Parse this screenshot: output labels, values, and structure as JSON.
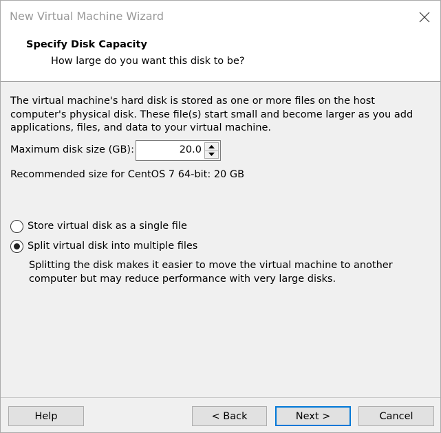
{
  "window": {
    "title": "New Virtual Machine Wizard"
  },
  "header": {
    "title": "Specify Disk Capacity",
    "subtitle": "How large do you want this disk to be?"
  },
  "body": {
    "description": "The virtual machine's hard disk is stored as one or more files on the host computer's physical disk. These file(s) start small and become larger as you add applications, files, and data to your virtual machine.",
    "disk_size_label": "Maximum disk size (GB):",
    "disk_size_value": "20.0",
    "recommended": "Recommended size for CentOS 7 64-bit: 20 GB"
  },
  "options": {
    "single_file_label": "Store virtual disk as a single file",
    "multiple_files_label": "Split virtual disk into multiple files",
    "selected": "multiple_files",
    "split_description": "Splitting the disk makes it easier to move the virtual machine to another computer but may reduce performance with very large disks."
  },
  "footer": {
    "help_label": "Help",
    "back_label": "< Back",
    "next_label": "Next >",
    "cancel_label": "Cancel"
  },
  "icons": {
    "close": "close-icon",
    "spin_up": "arrow-up-icon",
    "spin_down": "arrow-down-icon"
  },
  "colors": {
    "accent": "#0078d7",
    "dialog_bg": "#f0f0f0",
    "title_text": "#999999"
  }
}
